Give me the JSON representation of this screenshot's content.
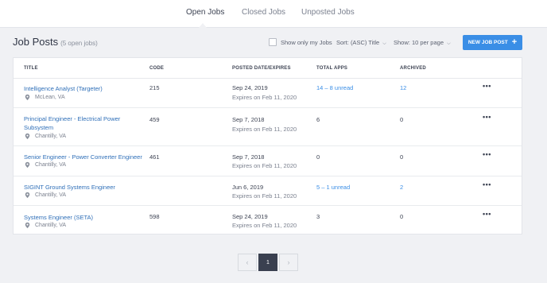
{
  "tabs": [
    {
      "label": "Open Jobs",
      "active": true
    },
    {
      "label": "Closed Jobs",
      "active": false
    },
    {
      "label": "Unposted Jobs",
      "active": false
    }
  ],
  "header": {
    "title": "Job Posts",
    "count": "(5 open jobs)",
    "show_only_mine": "Show only my Jobs",
    "sort_label": "Sort:",
    "sort_value": "(ASC) Title",
    "show_label": "Show:",
    "show_value": "10 per page",
    "new_button": "NEW JOB POST"
  },
  "table": {
    "columns": [
      "TITLE",
      "CODE",
      "POSTED DATE/EXPIRES",
      "TOTAL APPS",
      "ARCHIVED"
    ],
    "rows": [
      {
        "title": "Intelligence Analyst (Targeter)",
        "location": "McLean, VA",
        "code": "215",
        "posted": "Sep 24, 2019",
        "expires": "Expires on Feb 11, 2020",
        "apps": "14 – 8 unread",
        "apps_link": true,
        "archived": "12",
        "archived_link": true
      },
      {
        "title": "Principal Engineer - Electrical Power Subsystem",
        "location": "Chantilly, VA",
        "code": "459",
        "posted": "Sep 7, 2018",
        "expires": "Expires on Feb 11, 2020",
        "apps": "6",
        "apps_link": false,
        "archived": "0",
        "archived_link": false
      },
      {
        "title": "Senior Engineer - Power Converter Engineer",
        "location": "Chantilly, VA",
        "code": "461",
        "posted": "Sep 7, 2018",
        "expires": "Expires on Feb 11, 2020",
        "apps": "0",
        "apps_link": false,
        "archived": "0",
        "archived_link": false
      },
      {
        "title": "SIGINT Ground Systems Engineer",
        "location": "Chantilly, VA",
        "code": "",
        "posted": "Jun 6, 2019",
        "expires": "Expires on Feb 11, 2020",
        "apps": "5 – 1 unread",
        "apps_link": true,
        "archived": "2",
        "archived_link": true
      },
      {
        "title": "Systems Engineer (SETA)",
        "location": "Chantilly, VA",
        "code": "598",
        "posted": "Sep 24, 2019",
        "expires": "Expires on Feb 11, 2020",
        "apps": "3",
        "apps_link": false,
        "archived": "0",
        "archived_link": false
      }
    ],
    "row_menu": "•••"
  },
  "pagination": {
    "prev": "‹",
    "current": "1",
    "next": "›"
  },
  "icons": {
    "location": "map-pin-icon",
    "add": "plus-icon",
    "dropdown": "chevron-down-icon"
  },
  "colors": {
    "accent": "#3a8ee6",
    "link": "#2f6fb8",
    "text": "#3d4353",
    "muted": "#7b818f",
    "background": "#f0f1f4",
    "pager_active": "#3a4050"
  }
}
